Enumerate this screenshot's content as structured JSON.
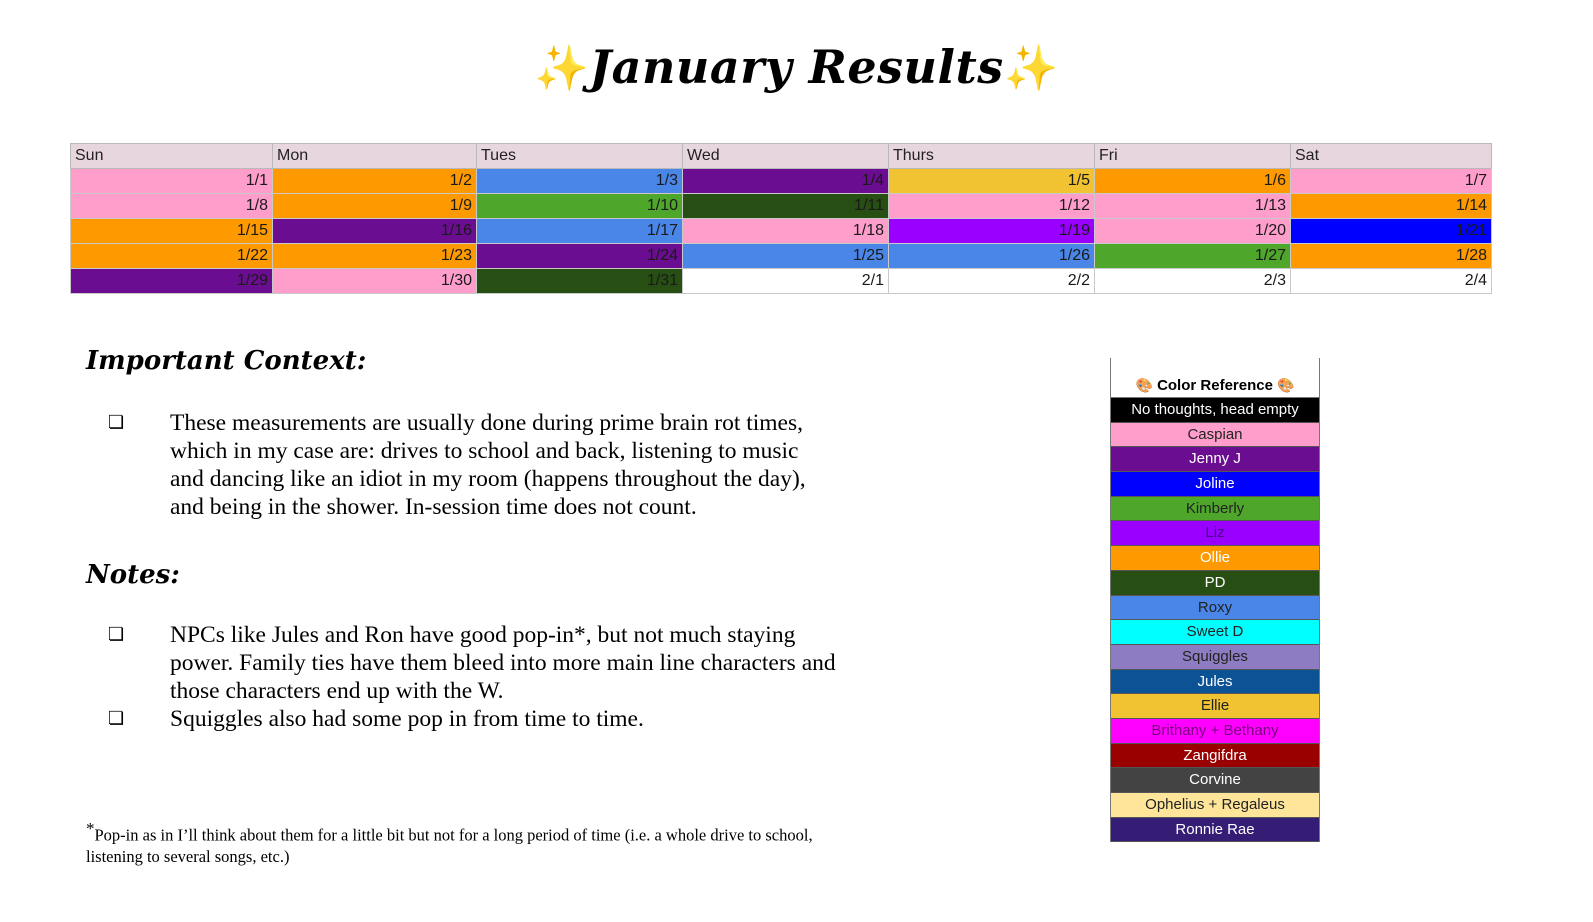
{
  "title": {
    "text": "January Results",
    "sparkle": "✨"
  },
  "calendar": {
    "headers": [
      "Sun",
      "Mon",
      "Tues",
      "Wed",
      "Thurs",
      "Fri",
      "Sat"
    ],
    "weeks": [
      [
        {
          "d": "1/1",
          "c": "#ff9ecb"
        },
        {
          "d": "1/2",
          "c": "#ff9900"
        },
        {
          "d": "1/3",
          "c": "#4a86e8"
        },
        {
          "d": "1/4",
          "c": "#6a0d91"
        },
        {
          "d": "1/5",
          "c": "#f1c232"
        },
        {
          "d": "1/6",
          "c": "#ff9900"
        },
        {
          "d": "1/7",
          "c": "#ff9ecb"
        }
      ],
      [
        {
          "d": "1/8",
          "c": "#ff9ecb"
        },
        {
          "d": "1/9",
          "c": "#ff9900"
        },
        {
          "d": "1/10",
          "c": "#4ea62b"
        },
        {
          "d": "1/11",
          "c": "#274e13"
        },
        {
          "d": "1/12",
          "c": "#ff9ecb"
        },
        {
          "d": "1/13",
          "c": "#ff9ecb"
        },
        {
          "d": "1/14",
          "c": "#ff9900"
        }
      ],
      [
        {
          "d": "1/15",
          "c": "#ff9900"
        },
        {
          "d": "1/16",
          "c": "#6a0d91"
        },
        {
          "d": "1/17",
          "c": "#4a86e8"
        },
        {
          "d": "1/18",
          "c": "#ff9ecb"
        },
        {
          "d": "1/19",
          "c": "#9900ff"
        },
        {
          "d": "1/20",
          "c": "#ff9ecb"
        },
        {
          "d": "1/21",
          "c": "#0000ff"
        }
      ],
      [
        {
          "d": "1/22",
          "c": "#ff9900"
        },
        {
          "d": "1/23",
          "c": "#ff9900"
        },
        {
          "d": "1/24",
          "c": "#6a0d91"
        },
        {
          "d": "1/25",
          "c": "#4a86e8"
        },
        {
          "d": "1/26",
          "c": "#4a86e8"
        },
        {
          "d": "1/27",
          "c": "#4ea62b"
        },
        {
          "d": "1/28",
          "c": "#ff9900"
        }
      ],
      [
        {
          "d": "1/29",
          "c": "#6a0d91"
        },
        {
          "d": "1/30",
          "c": "#ff9ecb"
        },
        {
          "d": "1/31",
          "c": "#274e13"
        },
        {
          "d": "2/1",
          "c": "#ffffff"
        },
        {
          "d": "2/2",
          "c": "#ffffff"
        },
        {
          "d": "2/3",
          "c": "#ffffff"
        },
        {
          "d": "2/4",
          "c": "#ffffff"
        }
      ]
    ]
  },
  "context": {
    "heading": "Important Context:",
    "items": [
      "These measurements are usually done during prime brain rot times, which in my case are: drives to school and back, listening to music and dancing like an idiot in my room (happens throughout the day), and being in the shower. In-session time does not count."
    ]
  },
  "notes": {
    "heading": "Notes:",
    "items": [
      "NPCs like Jules and Ron have good pop-in*, but not much staying power. Family ties have them bleed into more main line characters and those characters end up with the W.",
      "Squiggles also had some pop in from time to time."
    ]
  },
  "bullet_glyph": "❏",
  "footnote": {
    "marker": "*",
    "text": "Pop-in as in I’ll think about them for a little bit but not for a long period of time (i.e. a whole drive to school, listening to several songs, etc.)"
  },
  "color_reference": {
    "title": "Color Reference",
    "palette_icon": "🎨",
    "items": [
      {
        "name": "No thoughts, head empty",
        "bg": "#000000",
        "fg": "#ffffff"
      },
      {
        "name": "Caspian",
        "bg": "#ff9ecb",
        "fg": "#222222"
      },
      {
        "name": "Jenny J",
        "bg": "#6a0d91",
        "fg": "#ffffff"
      },
      {
        "name": "Joline",
        "bg": "#0000ff",
        "fg": "#ffffff"
      },
      {
        "name": "Kimberly",
        "bg": "#4ea62b",
        "fg": "#222222"
      },
      {
        "name": "Liz",
        "bg": "#9900ff",
        "fg": "#4a0080"
      },
      {
        "name": "Ollie",
        "bg": "#ff9900",
        "fg": "#ffffff"
      },
      {
        "name": "PD",
        "bg": "#274e13",
        "fg": "#ffffff"
      },
      {
        "name": "Roxy",
        "bg": "#4a86e8",
        "fg": "#222222"
      },
      {
        "name": "Sweet D",
        "bg": "#00ffff",
        "fg": "#222222"
      },
      {
        "name": "Squiggles",
        "bg": "#8e7cc3",
        "fg": "#222222"
      },
      {
        "name": "Jules",
        "bg": "#0b5394",
        "fg": "#ffffff"
      },
      {
        "name": "Ellie",
        "bg": "#f1c232",
        "fg": "#222222"
      },
      {
        "name": "Brithany + Bethany",
        "bg": "#ff00ff",
        "fg": "#7a0080"
      },
      {
        "name": "Zangifdra",
        "bg": "#990000",
        "fg": "#ffffff"
      },
      {
        "name": "Corvine",
        "bg": "#434343",
        "fg": "#ffffff"
      },
      {
        "name": "Ophelius + Regaleus",
        "bg": "#ffe599",
        "fg": "#222222"
      },
      {
        "name": "Ronnie Rae",
        "bg": "#351c75",
        "fg": "#ffffff"
      }
    ]
  }
}
